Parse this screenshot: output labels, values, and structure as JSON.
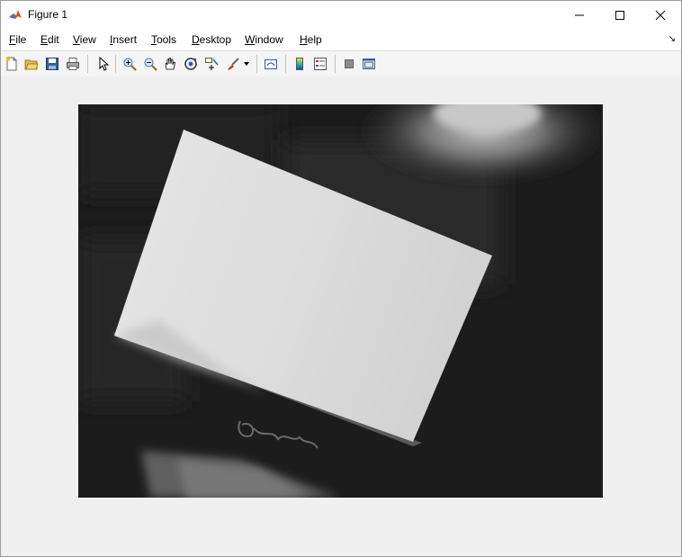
{
  "window": {
    "title": "Figure 1",
    "controls": [
      "minimize",
      "maximize",
      "close"
    ]
  },
  "menu": {
    "items": [
      {
        "label": "File",
        "mnemonic": "F",
        "rest": "ile"
      },
      {
        "label": "Edit",
        "mnemonic": "E",
        "rest": "dit"
      },
      {
        "label": "View",
        "mnemonic": "V",
        "rest": "iew"
      },
      {
        "label": "Insert",
        "mnemonic": "I",
        "rest": "nsert"
      },
      {
        "label": "Tools",
        "mnemonic": "T",
        "rest": "ools"
      },
      {
        "label": "Desktop",
        "mnemonic": "D",
        "rest": "esktop"
      },
      {
        "label": "Window",
        "mnemonic": "W",
        "rest": "indow"
      },
      {
        "label": "Help",
        "mnemonic": "H",
        "rest": "elp"
      }
    ]
  },
  "toolbar": {
    "buttons": [
      "new-figure-icon",
      "open-file-icon",
      "save-icon",
      "print-icon",
      "edit-plot-icon",
      "zoom-in-icon",
      "zoom-out-icon",
      "pan-icon",
      "rotate-3d-icon",
      "data-cursor-icon",
      "brush-icon",
      "brush-dropdown-icon",
      "link-plot-icon",
      "insert-colorbar-icon",
      "insert-legend-icon",
      "hide-plot-tools-icon",
      "show-plot-tools-icon"
    ]
  },
  "figure": {
    "image": {
      "description_colors": {
        "background": "#1c1c1c",
        "card": "#e0e0e0"
      }
    }
  }
}
